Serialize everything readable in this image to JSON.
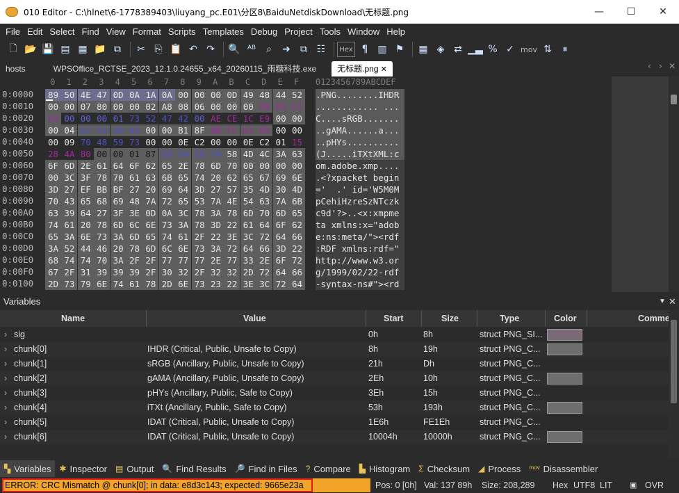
{
  "window": {
    "title": "010 Editor - C:\\hlnet\\6-1778389403\\liuyang_pc.E01\\分区8\\BaiduNetdiskDownload\\无标题.png",
    "controls": [
      "—",
      "☐",
      "✕"
    ]
  },
  "menu": [
    "File",
    "Edit",
    "Select",
    "Find",
    "View",
    "Format",
    "Scripts",
    "Templates",
    "Debug",
    "Project",
    "Tools",
    "Window",
    "Help"
  ],
  "toolbar": {
    "icons": [
      "new-file-icon",
      "open-file-icon",
      "save-icon",
      "save-as-icon",
      "save-all-icon",
      "open-folder-icon",
      "workspace-icon",
      "cut-icon",
      "copy-icon",
      "paste-icon",
      "undo-icon",
      "redo-icon",
      "find-icon",
      "find-replace-icon",
      "find-in-files-icon",
      "goto-icon",
      "compare-icon",
      "template-icon",
      "hex-mode-icon",
      "show-whitespace-icon",
      "columns-icon",
      "bookmark-icon",
      "calculator-icon",
      "inspector-icon",
      "swap-icon",
      "histogram-icon",
      "percent-icon",
      "checksum-icon",
      "mov-icon",
      "convert-icon",
      "pause-icon"
    ],
    "hex_label": "Hex",
    "mov_label": "mov"
  },
  "tabs": [
    {
      "label": "hosts",
      "active": false
    },
    {
      "label": "WPSOffice_RCTSE_2023_12.1.0.24655_x64_20260115_雨糖科技.exe",
      "active": false
    },
    {
      "label": "无标题.png",
      "active": true
    }
  ],
  "hexview": {
    "ruler_hex": [
      "0",
      "1",
      "2",
      "3",
      "4",
      "5",
      "6",
      "7",
      "8",
      "9",
      "A",
      "B",
      "C",
      "D",
      "E",
      "F"
    ],
    "ruler_ascii": "0123456789ABCDEF",
    "rows": [
      {
        "addr": "0:0000",
        "bytes": [
          "89",
          "50",
          "4E",
          "47",
          "0D",
          "0A",
          "1A",
          "0A",
          "00",
          "00",
          "00",
          "0D",
          "49",
          "48",
          "44",
          "52"
        ],
        "ascii": ".PNG........IHDR"
      },
      {
        "addr": "0:0010",
        "bytes": [
          "00",
          "00",
          "07",
          "80",
          "00",
          "00",
          "02",
          "A8",
          "08",
          "06",
          "00",
          "00",
          "00",
          "E8",
          "D3",
          "C1"
        ],
        "ascii": "............ ..."
      },
      {
        "addr": "0:0020",
        "bytes": [
          "43",
          "00",
          "00",
          "00",
          "01",
          "73",
          "52",
          "47",
          "42",
          "00",
          "AE",
          "CE",
          "1C",
          "E9",
          "00",
          "00"
        ],
        "ascii": "C....sRGB......."
      },
      {
        "addr": "0:0030",
        "bytes": [
          "00",
          "04",
          "67",
          "41",
          "4D",
          "41",
          "00",
          "00",
          "B1",
          "8F",
          "0B",
          "FC",
          "61",
          "05",
          "00",
          "00"
        ],
        "ascii": "..gAMA......a..."
      },
      {
        "addr": "0:0040",
        "bytes": [
          "00",
          "09",
          "70",
          "48",
          "59",
          "73",
          "00",
          "00",
          "0E",
          "C2",
          "00",
          "00",
          "0E",
          "C2",
          "01",
          "15"
        ],
        "ascii": "..pHYs.........."
      },
      {
        "addr": "0:0050",
        "bytes": [
          "28",
          "4A",
          "80",
          "00",
          "00",
          "01",
          "87",
          "69",
          "54",
          "58",
          "74",
          "58",
          "4D",
          "4C",
          "3A",
          "63"
        ],
        "ascii": "(J.....iTXtXML:c"
      },
      {
        "addr": "0:0060",
        "bytes": [
          "6F",
          "6D",
          "2E",
          "61",
          "64",
          "6F",
          "62",
          "65",
          "2E",
          "78",
          "6D",
          "70",
          "00",
          "00",
          "00",
          "00"
        ],
        "ascii": "om.adobe.xmp...."
      },
      {
        "addr": "0:0070",
        "bytes": [
          "00",
          "3C",
          "3F",
          "78",
          "70",
          "61",
          "63",
          "6B",
          "65",
          "74",
          "20",
          "62",
          "65",
          "67",
          "69",
          "6E"
        ],
        "ascii": ".<?xpacket begin"
      },
      {
        "addr": "0:0080",
        "bytes": [
          "3D",
          "27",
          "EF",
          "BB",
          "BF",
          "27",
          "20",
          "69",
          "64",
          "3D",
          "27",
          "57",
          "35",
          "4D",
          "30",
          "4D"
        ],
        "ascii": "='  .' id='W5M0M"
      },
      {
        "addr": "0:0090",
        "bytes": [
          "70",
          "43",
          "65",
          "68",
          "69",
          "48",
          "7A",
          "72",
          "65",
          "53",
          "7A",
          "4E",
          "54",
          "63",
          "7A",
          "6B"
        ],
        "ascii": "pCehiHzreSzNTczk"
      },
      {
        "addr": "0:00A0",
        "bytes": [
          "63",
          "39",
          "64",
          "27",
          "3F",
          "3E",
          "0D",
          "0A",
          "3C",
          "78",
          "3A",
          "78",
          "6D",
          "70",
          "6D",
          "65"
        ],
        "ascii": "c9d'?>..<x:xmpme"
      },
      {
        "addr": "0:00B0",
        "bytes": [
          "74",
          "61",
          "20",
          "78",
          "6D",
          "6C",
          "6E",
          "73",
          "3A",
          "78",
          "3D",
          "22",
          "61",
          "64",
          "6F",
          "62"
        ],
        "ascii": "ta xmlns:x=\"adob"
      },
      {
        "addr": "0:00C0",
        "bytes": [
          "65",
          "3A",
          "6E",
          "73",
          "3A",
          "6D",
          "65",
          "74",
          "61",
          "2F",
          "22",
          "3E",
          "3C",
          "72",
          "64",
          "66"
        ],
        "ascii": "e:ns:meta/\"><rdf"
      },
      {
        "addr": "0:00D0",
        "bytes": [
          "3A",
          "52",
          "44",
          "46",
          "20",
          "78",
          "6D",
          "6C",
          "6E",
          "73",
          "3A",
          "72",
          "64",
          "66",
          "3D",
          "22"
        ],
        "ascii": ":RDF xmlns:rdf=\""
      },
      {
        "addr": "0:00E0",
        "bytes": [
          "68",
          "74",
          "74",
          "70",
          "3A",
          "2F",
          "2F",
          "77",
          "77",
          "77",
          "2E",
          "77",
          "33",
          "2E",
          "6F",
          "72"
        ],
        "ascii": "http://www.w3.or"
      },
      {
        "addr": "0:00F0",
        "bytes": [
          "67",
          "2F",
          "31",
          "39",
          "39",
          "39",
          "2F",
          "30",
          "32",
          "2F",
          "32",
          "32",
          "2D",
          "72",
          "64",
          "66"
        ],
        "ascii": "g/1999/02/22-rdf"
      },
      {
        "addr": "0:0100",
        "bytes": [
          "2D",
          "73",
          "79",
          "6E",
          "74",
          "61",
          "78",
          "2D",
          "6E",
          "73",
          "23",
          "22",
          "3E",
          "3C",
          "72",
          "64"
        ],
        "ascii": "-syntax-ns#\"><rd"
      }
    ]
  },
  "variables": {
    "title": "Variables",
    "columns": [
      "Name",
      "Value",
      "Start",
      "Size",
      "Type",
      "Color",
      "Comme"
    ],
    "rows": [
      {
        "name": "sig",
        "value": "",
        "start": "0h",
        "size": "8h",
        "type": "struct PNG_SI...",
        "color": "#7a6a78"
      },
      {
        "name": "chunk[0]",
        "value": "IHDR  (Critical, Public, Unsafe to Copy)",
        "start": "8h",
        "size": "19h",
        "type": "struct PNG_C...",
        "color": "#6e6e6e"
      },
      {
        "name": "chunk[1]",
        "value": "sRGB  (Ancillary, Public, Unsafe to Copy)",
        "start": "21h",
        "size": "Dh",
        "type": "struct PNG_C...",
        "color": ""
      },
      {
        "name": "chunk[2]",
        "value": "gAMA  (Ancillary, Public, Unsafe to Copy)",
        "start": "2Eh",
        "size": "10h",
        "type": "struct PNG_C...",
        "color": "#6e6e6e"
      },
      {
        "name": "chunk[3]",
        "value": "pHYs  (Ancillary, Public, Safe to Copy)",
        "start": "3Eh",
        "size": "15h",
        "type": "struct PNG_C...",
        "color": ""
      },
      {
        "name": "chunk[4]",
        "value": "iTXt  (Ancillary, Public, Safe to Copy)",
        "start": "53h",
        "size": "193h",
        "type": "struct PNG_C...",
        "color": "#6e6e6e"
      },
      {
        "name": "chunk[5]",
        "value": "IDAT  (Critical, Public, Unsafe to Copy)",
        "start": "1E6h",
        "size": "FE1Eh",
        "type": "struct PNG_C...",
        "color": ""
      },
      {
        "name": "chunk[6]",
        "value": "IDAT  (Critical, Public, Unsafe to Copy)",
        "start": "10004h",
        "size": "10000h",
        "type": "struct PNG_C...",
        "color": "#6e6e6e"
      }
    ]
  },
  "bottom_tabs": [
    {
      "label": "Variables",
      "icon": "variables-icon",
      "active": true
    },
    {
      "label": "Inspector",
      "icon": "inspector-icon",
      "active": false
    },
    {
      "label": "Output",
      "icon": "output-icon",
      "active": false
    },
    {
      "label": "Find Results",
      "icon": "find-results-icon",
      "active": false
    },
    {
      "label": "Find in Files",
      "icon": "find-in-files-icon",
      "active": false
    },
    {
      "label": "Compare",
      "icon": "compare-icon",
      "active": false
    },
    {
      "label": "Histogram",
      "icon": "histogram-icon",
      "active": false
    },
    {
      "label": "Checksum",
      "icon": "checksum-icon",
      "active": false
    },
    {
      "label": "Process",
      "icon": "process-icon",
      "active": false
    },
    {
      "label": "Disassembler",
      "icon": "disassembler-icon",
      "active": false
    }
  ],
  "status": {
    "error": "ERROR: CRC Mismatch @ chunk[0]; in data: e8d3c143; expected: 9665e23a",
    "pos": "Pos: 0 [0h]",
    "val": "Val: 137 89h",
    "size": "Size: 208,289",
    "hex": "Hex",
    "encoding": "UTF8",
    "lit": "LIT",
    "ovr": "OVR"
  },
  "colors": {
    "header_sel": "#6f6d8d",
    "chunk0": "#4a4a4a",
    "chunk1_text": "#4b4bc6",
    "chunk2_text": "#9b2c9b",
    "error_bg": "#f0a52a",
    "error_border": "#e21b1b"
  }
}
